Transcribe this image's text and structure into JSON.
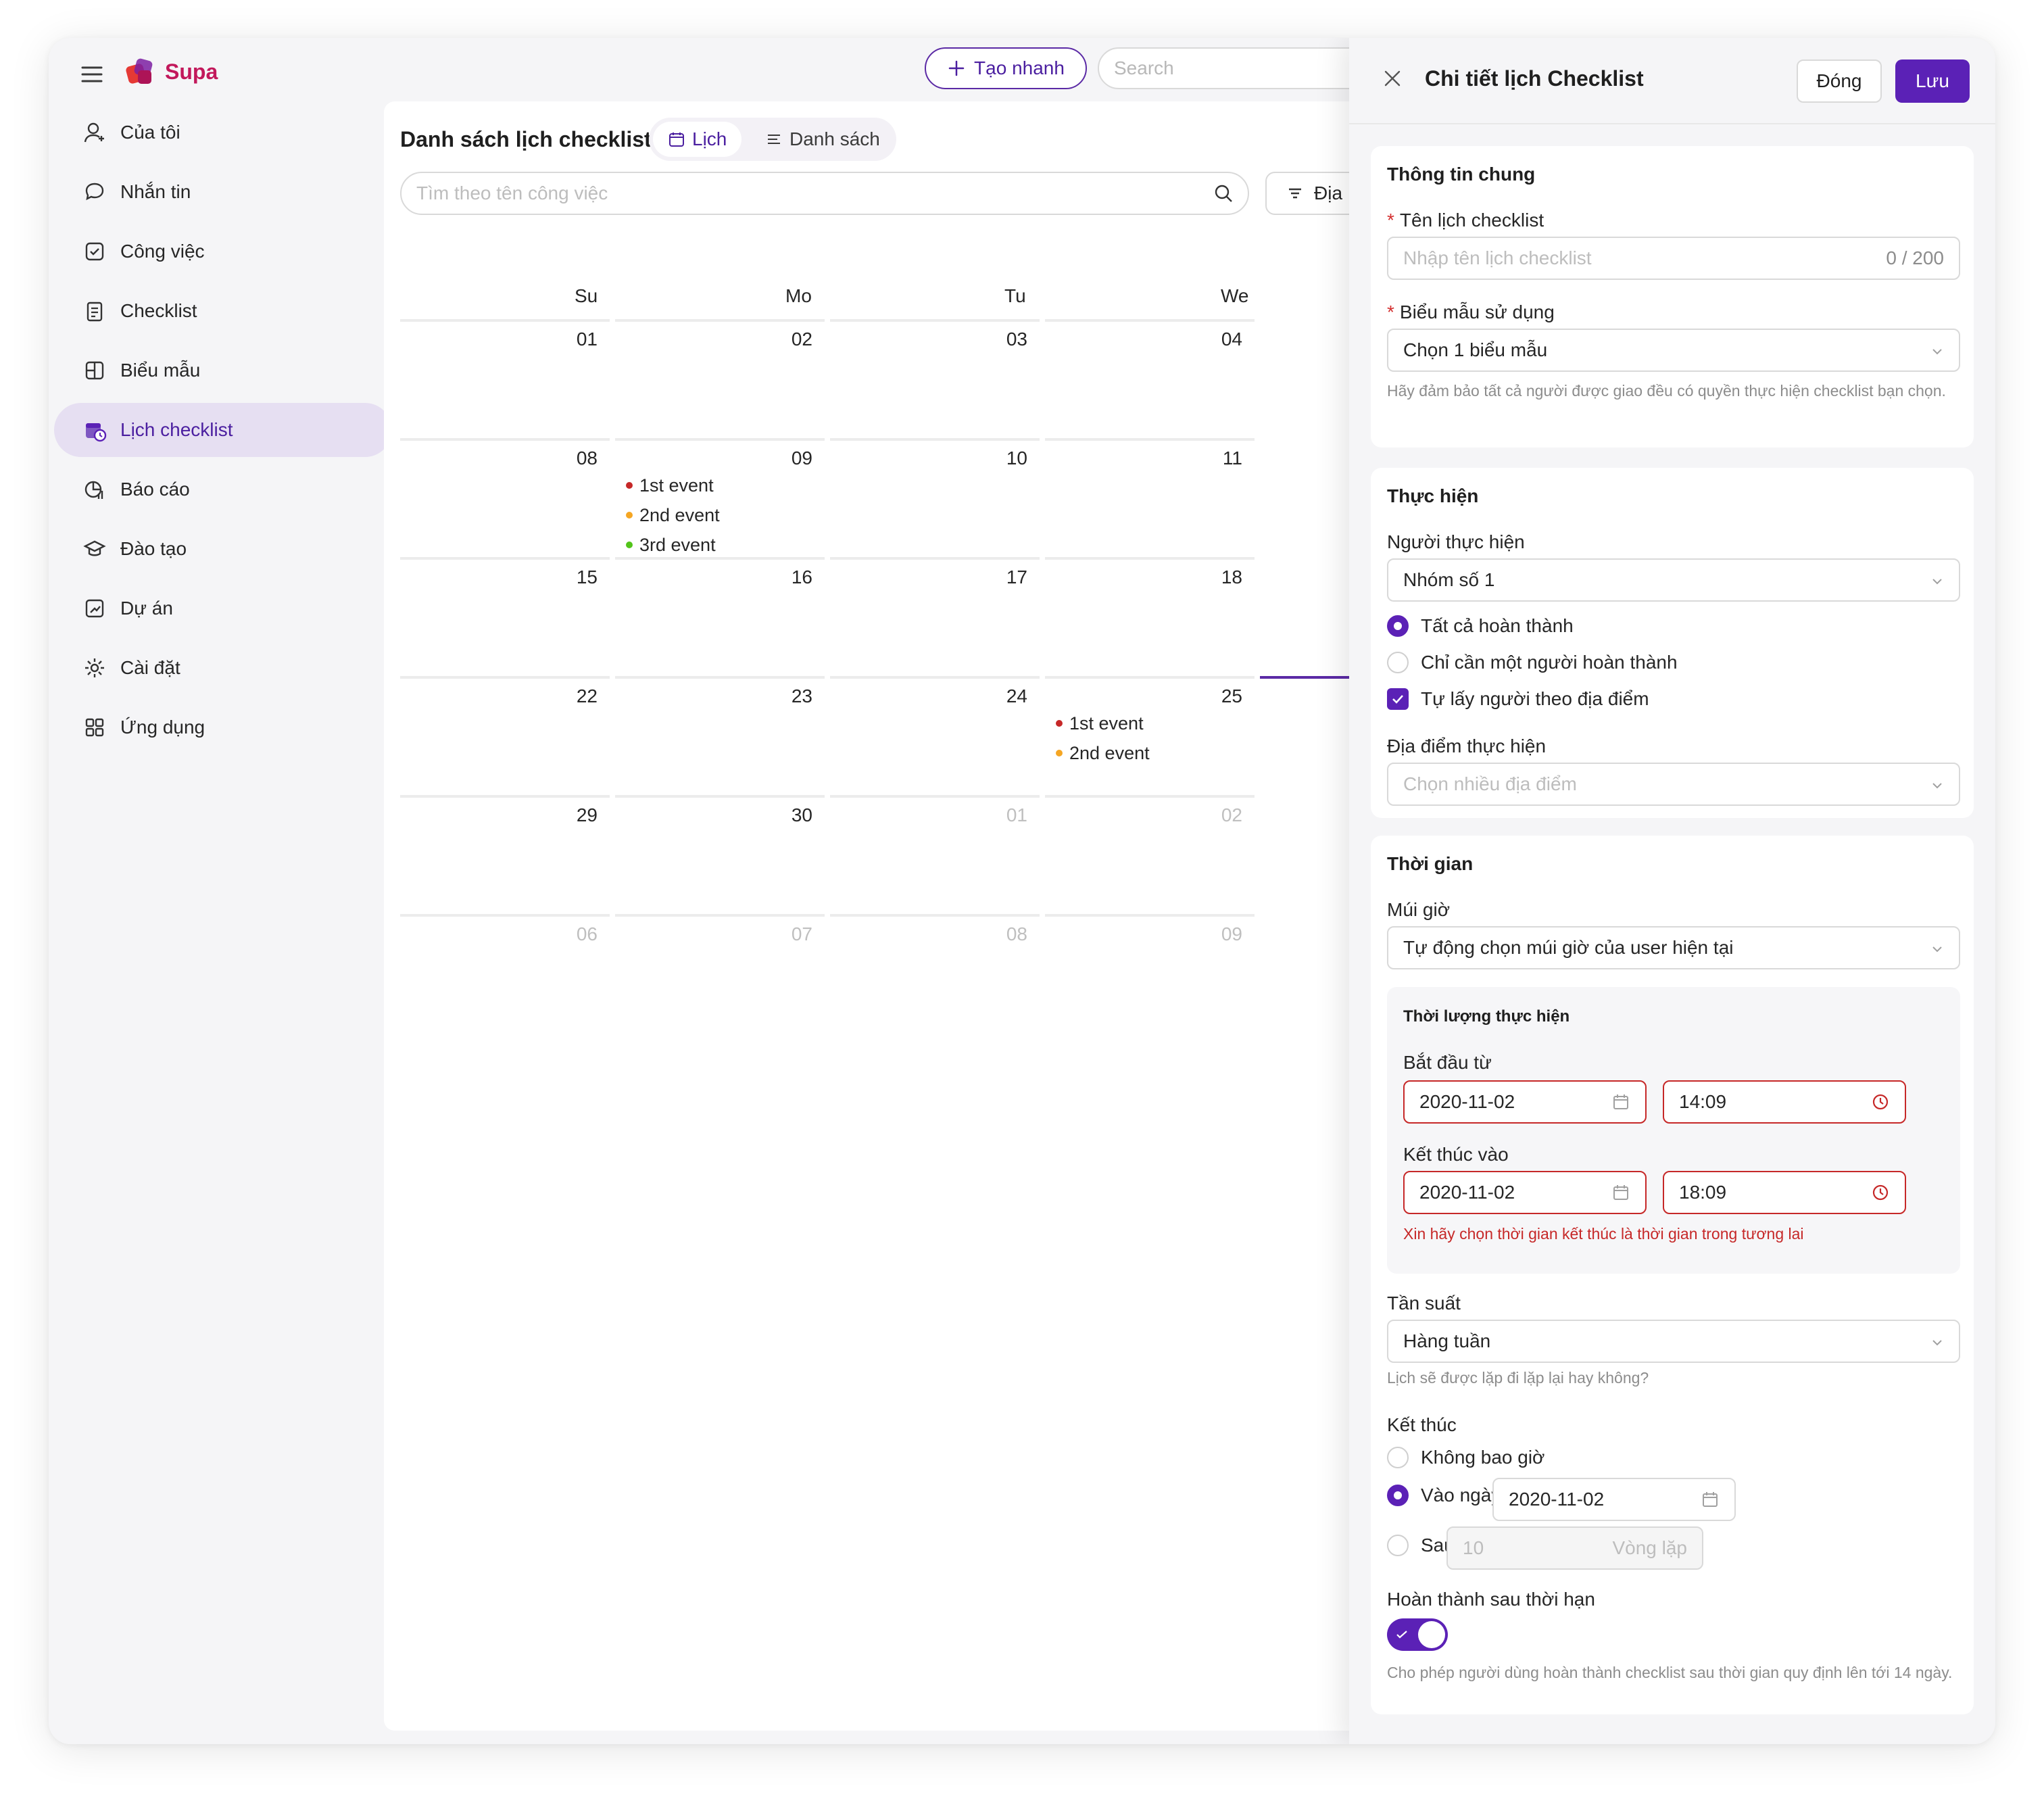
{
  "app": {
    "brand": "Supa"
  },
  "header": {
    "quick_create": "Tạo nhanh",
    "search_placeholder": "Search"
  },
  "sidebar": {
    "items": [
      {
        "label": "Của tôi",
        "icon": "user-icon"
      },
      {
        "label": "Nhắn tin",
        "icon": "chat-icon"
      },
      {
        "label": "Công việc",
        "icon": "task-icon"
      },
      {
        "label": "Checklist",
        "icon": "clipboard-icon"
      },
      {
        "label": "Biểu mẫu",
        "icon": "form-icon"
      },
      {
        "label": "Lịch checklist",
        "icon": "calendar-checklist-icon",
        "active": true
      },
      {
        "label": "Báo cáo",
        "icon": "report-icon"
      },
      {
        "label": "Đào tạo",
        "icon": "training-icon"
      },
      {
        "label": "Dự án",
        "icon": "project-icon"
      },
      {
        "label": "Cài đặt",
        "icon": "settings-icon"
      },
      {
        "label": "Ứng dụng",
        "icon": "apps-icon"
      }
    ]
  },
  "main": {
    "title": "Danh sách lịch checklist",
    "view_tabs": {
      "calendar": "Lịch",
      "list": "Danh sách"
    },
    "filter_placeholder": "Tìm theo tên công việc",
    "filter_button": "Địa",
    "weekdays": [
      "Su",
      "Mo",
      "Tu",
      "We"
    ],
    "weeks": [
      [
        {
          "d": "01"
        },
        {
          "d": "02"
        },
        {
          "d": "03"
        },
        {
          "d": "04"
        }
      ],
      [
        {
          "d": "08"
        },
        {
          "d": "09"
        },
        {
          "d": "10"
        },
        {
          "d": "11"
        }
      ],
      [
        {
          "d": "15"
        },
        {
          "d": "16"
        },
        {
          "d": "17"
        },
        {
          "d": "18"
        }
      ],
      [
        {
          "d": "22"
        },
        {
          "d": "23"
        },
        {
          "d": "24"
        },
        {
          "d": "25"
        }
      ],
      [
        {
          "d": "29"
        },
        {
          "d": "30"
        },
        {
          "d": "01"
        },
        {
          "d": "02"
        }
      ],
      [
        {
          "d": "06"
        },
        {
          "d": "07"
        },
        {
          "d": "08"
        },
        {
          "d": "09"
        }
      ]
    ],
    "events_week2_mo": [
      "1st event",
      "2nd event",
      "3rd event"
    ],
    "events_week4_tu": [
      "1st event",
      "2nd event"
    ],
    "event_colors": [
      "#c62828",
      "#f5a623",
      "#52c41a"
    ]
  },
  "drawer": {
    "title": "Chi tiết lịch Checklist",
    "close_label": "Đóng",
    "save_label": "Lưu",
    "general": {
      "title": "Thông tin chung",
      "name_label": "Tên lịch checklist",
      "name_placeholder": "Nhập tên lịch checklist",
      "name_count": "0 / 200",
      "template_label": "Biểu mẫu sử dụng",
      "template_value": "Chọn 1 biểu mẫu",
      "template_help": "Hãy đảm bảo tất cả người được giao đều có quyền thực hiện checklist bạn chọn."
    },
    "execution": {
      "title": "Thực hiện",
      "assignee_label": "Người thực hiện",
      "assignee_value": "Nhóm số 1",
      "option_all": "Tất cả hoàn thành",
      "option_one": "Chỉ cần một người hoàn thành",
      "option_location": "Tự lấy người theo địa điểm",
      "location_label": "Địa điểm thực hiện",
      "location_placeholder": "Chọn nhiều địa điểm"
    },
    "time": {
      "title": "Thời gian",
      "tz_label": "Múi giờ",
      "tz_value": "Tự động chọn múi giờ của user hiện tại",
      "duration_title": "Thời lượng thực hiện",
      "start_label": "Bắt đầu từ",
      "start_date": "2020-11-02",
      "start_time": "14:09",
      "end_label": "Kết thúc vào",
      "end_date": "2020-11-02",
      "end_time": "18:09",
      "error": "Xin hãy chọn thời gian kết thúc là thời gian trong tương lai",
      "freq_label": "Tần suất",
      "freq_value": "Hàng tuần",
      "freq_help": "Lịch sẽ được lặp đi lặp lại hay không?",
      "end_section_label": "Kết thúc",
      "end_never": "Không bao giờ",
      "end_on_date": "Vào ngày",
      "end_on_date_value": "2020-11-02",
      "end_after": "Sau",
      "end_after_value": "10",
      "end_after_unit": "Vòng lặp",
      "late_label": "Hoàn thành sau thời hạn",
      "late_help": "Cho phép người dùng hoàn thành checklist sau thời gian quy định lên tới 14 ngày."
    }
  },
  "colors": {
    "accent": "#5b21b6",
    "brand": "#c2185b",
    "error": "#c62828"
  }
}
